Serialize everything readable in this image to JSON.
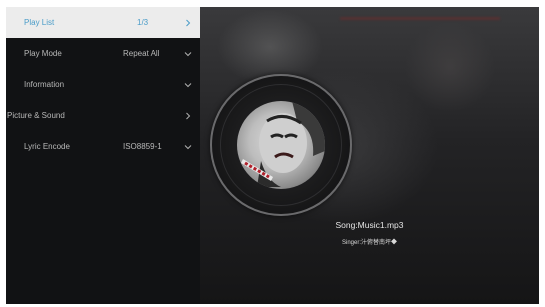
{
  "menu": {
    "items": [
      {
        "label": "Play List",
        "value": "1/3",
        "chevron": "chevron-right-icon"
      },
      {
        "label": "Play Mode",
        "value": "Repeat All",
        "chevron": "chevron-down-icon"
      },
      {
        "label": "Information",
        "value": "",
        "chevron": "chevron-down-icon"
      },
      {
        "label": "Picture & Sound",
        "value": "",
        "chevron": "chevron-right-icon"
      },
      {
        "label": "Lyric Encode",
        "value": "ISO8859-1",
        "chevron": "chevron-down-icon"
      }
    ]
  },
  "player": {
    "song": "Song:Music1.mp3",
    "singer": "Singer:汁俯替南坪◆"
  },
  "colors": {
    "active_text": "#4a9cc8",
    "active_bg": "#ececec",
    "sidebar_bg": "#111214"
  }
}
